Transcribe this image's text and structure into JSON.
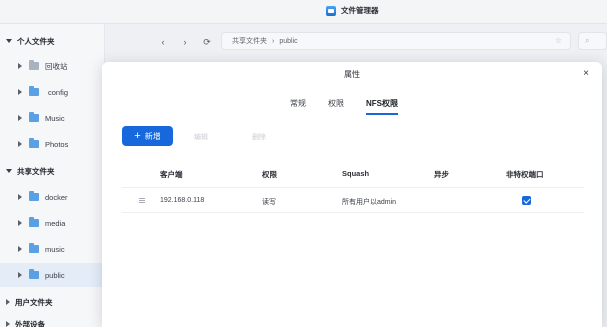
{
  "window": {
    "title": "文件管理器"
  },
  "sidebar": {
    "personal": {
      "label": "个人文件夹",
      "items": [
        {
          "label": "回收站"
        },
        {
          "label": "config"
        },
        {
          "label": "Music"
        },
        {
          "label": "Photos"
        }
      ]
    },
    "shared": {
      "label": "共享文件夹",
      "items": [
        {
          "label": "docker"
        },
        {
          "label": "media"
        },
        {
          "label": "music"
        },
        {
          "label": "public"
        }
      ]
    },
    "user": {
      "label": "用户文件夹"
    },
    "external": {
      "label": "外部设备"
    }
  },
  "toolbar": {
    "path": [
      "共享文件夹",
      "public"
    ],
    "path_sep": "›"
  },
  "dialog": {
    "title": "属性",
    "close": "×",
    "tabs": [
      "常规",
      "权限",
      "NFS权限"
    ],
    "active_tab": 2,
    "add_label": "新增",
    "ghost1": "编辑",
    "ghost2": "删除",
    "columns": [
      "客户端",
      "权限",
      "Squash",
      "异步",
      "非特权端口"
    ],
    "rows": [
      {
        "client": "192.168.0.118",
        "perm": "读写",
        "squash": "所有用户以admin",
        "async": "",
        "nonpriv": true
      }
    ]
  },
  "colors": {
    "accent": "#1668dc",
    "folder": "#5b9fe4"
  }
}
